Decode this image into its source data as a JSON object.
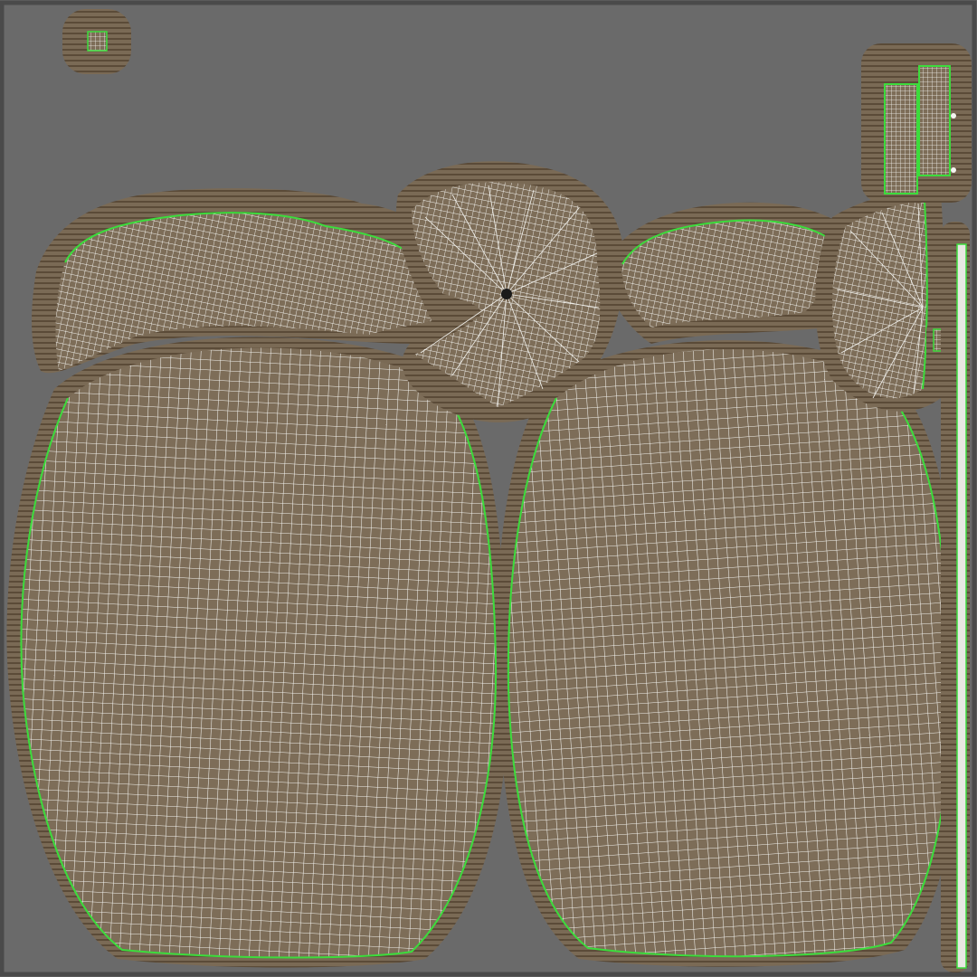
{
  "image": {
    "kind": "uv-texture-layout",
    "description_visible_text": [],
    "colors": {
      "canvas_background": "#6a6a6a",
      "frame": "#4a4a4a",
      "bleed_fill": "#7a6a55",
      "bleed_dark": "#4e3f2e",
      "island_fill": "#7d6d58",
      "wire": "#f4f4f0",
      "seam": "#3cdc3c"
    },
    "islands": [
      {
        "name": "bag-body-left"
      },
      {
        "name": "bag-neck-left"
      },
      {
        "name": "bag-top-cap-left"
      },
      {
        "name": "bag-body-right"
      },
      {
        "name": "bag-neck-right"
      },
      {
        "name": "bag-top-cap-right"
      },
      {
        "name": "strap-piece-a"
      },
      {
        "name": "strap-piece-b"
      },
      {
        "name": "small-square-patch"
      },
      {
        "name": "small-square-patch-2"
      },
      {
        "name": "long-strap-strip"
      }
    ]
  }
}
